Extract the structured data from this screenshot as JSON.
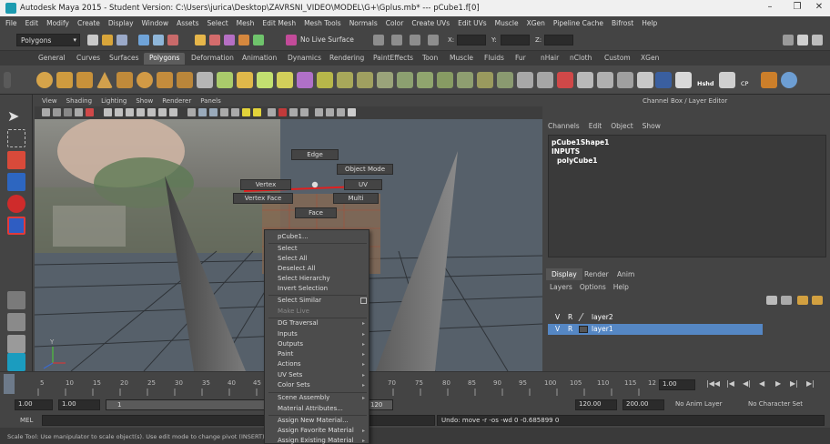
{
  "window": {
    "title": "Autodesk Maya 2015 - Student Version: C:\\Users\\jurica\\Desktop\\ZAVRSNI_VIDEO\\MODEL\\G+\\Gplus.mb*  ---  pCube1.f[0]",
    "minimize": "–",
    "maximize": "❐",
    "close": "✕"
  },
  "menubar": [
    "File",
    "Edit",
    "Modify",
    "Create",
    "Display",
    "Window",
    "Assets",
    "Select",
    "Mesh",
    "Edit Mesh",
    "Mesh Tools",
    "Normals",
    "Color",
    "Create UVs",
    "Edit UVs",
    "Muscle",
    "XGen",
    "Pipeline Cache",
    "Bifrost",
    "Help"
  ],
  "statusline": {
    "mode": "Polygons",
    "no_live": "No Live Surface",
    "x_label": "X:",
    "y_label": "Y:",
    "z_label": "Z:"
  },
  "shelf_tabs": [
    "General",
    "Curves",
    "Surfaces",
    "Polygons",
    "Deformation",
    "Animation",
    "Dynamics",
    "Rendering",
    "PaintEffects",
    "Toon",
    "Muscle",
    "Fluids",
    "Fur",
    "nHair",
    "nCloth",
    "Custom",
    "XGen"
  ],
  "shelf_active_tab": "Polygons",
  "shelf_labels": {
    "hshd": "Hshd",
    "cp": "CP"
  },
  "viewport": {
    "menu": [
      "View",
      "Shading",
      "Lighting",
      "Show",
      "Renderer",
      "Panels"
    ],
    "axis_y": "Y"
  },
  "marking_menu": {
    "edge": "Edge",
    "object_mode": "Object Mode",
    "vertex": "Vertex",
    "uv": "UV",
    "vertex_face": "Vertex Face",
    "multi": "Multi",
    "face": "Face"
  },
  "context_menu": {
    "title": "pCube1...",
    "items": [
      {
        "label": "Select"
      },
      {
        "label": "Select All"
      },
      {
        "label": "Deselect All"
      },
      {
        "label": "Select Hierarchy"
      },
      {
        "label": "Invert Selection"
      },
      {
        "label": "Select Similar"
      },
      {
        "label": "Make Live"
      },
      {
        "label": "DG Traversal"
      },
      {
        "label": "Inputs"
      },
      {
        "label": "Outputs"
      },
      {
        "label": "Paint"
      },
      {
        "label": "Actions"
      },
      {
        "label": "UV Sets"
      },
      {
        "label": "Color Sets"
      },
      {
        "label": "Scene Assembly"
      },
      {
        "label": "Material Attributes..."
      },
      {
        "label": "Assign New Material..."
      },
      {
        "label": "Assign Favorite Material"
      },
      {
        "label": "Assign Existing Material"
      }
    ]
  },
  "channel_box": {
    "header": "Channel Box / Layer Editor",
    "menu": [
      "Channels",
      "Edit",
      "Object",
      "Show"
    ],
    "shape": "pCube1Shape1",
    "inputs": "INPUTS",
    "node": "polyCube1"
  },
  "layer_editor": {
    "tabs": [
      "Display",
      "Render",
      "Anim"
    ],
    "active_tab": "Display",
    "menu": [
      "Layers",
      "Options",
      "Help"
    ],
    "layers": [
      {
        "v": "V",
        "r": "R",
        "name": "layer2",
        "selected": false
      },
      {
        "v": "V",
        "r": "R",
        "name": "layer1",
        "selected": true
      }
    ]
  },
  "timeline": {
    "ticks": [
      "5",
      "10",
      "15",
      "20",
      "25",
      "30",
      "35",
      "40",
      "45",
      "70",
      "75",
      "80",
      "85",
      "90",
      "95",
      "100",
      "105",
      "110",
      "115",
      "12"
    ],
    "current_frame": "1.00"
  },
  "range": {
    "start": "1.00",
    "playback_start": "1.00",
    "range_start": "1",
    "range_end": "120",
    "playback_end": "120.00",
    "end": "200.00",
    "anim_layer": "No Anim Layer",
    "character_set": "No Character Set"
  },
  "command": {
    "label": "MEL",
    "result": "Undo: move -r -os -wd 0 -0.685899 0"
  },
  "help_line": "Scale Tool: Use manipulator to scale object(s). Use edit mode to change pivot (INSERT)."
}
